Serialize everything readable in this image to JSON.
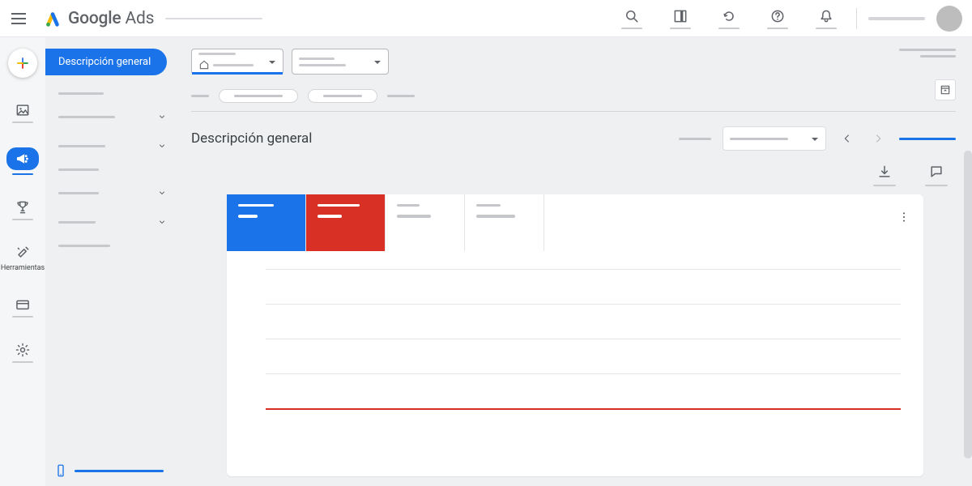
{
  "header": {
    "product_bold": "Google",
    "product_light": "Ads"
  },
  "rail": {
    "tools_label": "Herramientas"
  },
  "nav": {
    "active_label": "Descripción general"
  },
  "page": {
    "title": "Descripción general"
  },
  "colors": {
    "primary": "#1a73e8",
    "danger": "#d93025"
  },
  "chart_data": {
    "type": "line",
    "series": [
      {
        "name": "metric-blue",
        "values": [
          0,
          0,
          0,
          0,
          0,
          0,
          0,
          0,
          0,
          0
        ],
        "color": "#1a73e8"
      },
      {
        "name": "metric-red",
        "values": [
          0,
          0,
          0,
          0,
          0,
          0,
          0,
          0,
          0,
          0
        ],
        "color": "#d93025"
      }
    ],
    "ylim": [
      0,
      5
    ],
    "grid_lines": 5,
    "title": "",
    "xlabel": "",
    "ylabel": ""
  }
}
